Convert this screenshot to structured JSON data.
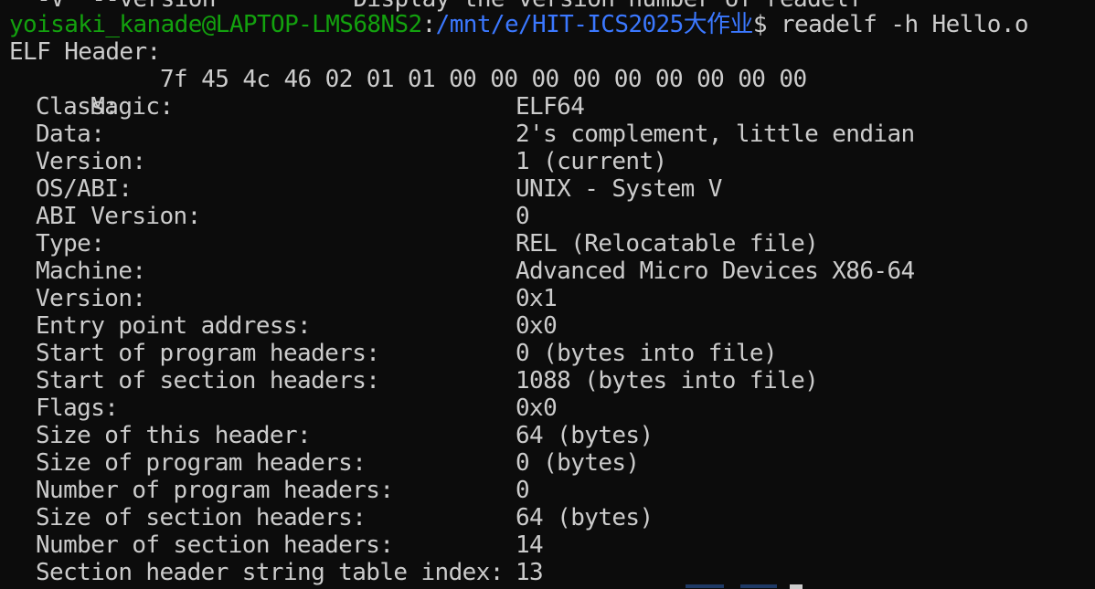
{
  "scrollback_top": "  -V  --version          Display the version number of readelf",
  "prompt": {
    "user_host": "yoisaki_kanade@LAPTOP-LMS68NS2",
    "separator": ":",
    "path": "/mnt/e/HIT-ICS2025大作业",
    "symbol": "$",
    "command": " readelf -h Hello.o"
  },
  "header_title": "ELF Header:",
  "magic": {
    "label": "Magic:",
    "value": "7f 45 4c 46 02 01 01 00 00 00 00 00 00 00 00 00"
  },
  "fields": [
    {
      "label": "Class:",
      "value": "ELF64"
    },
    {
      "label": "Data:",
      "value": "2's complement, little endian"
    },
    {
      "label": "Version:",
      "value": "1 (current)"
    },
    {
      "label": "OS/ABI:",
      "value": "UNIX - System V"
    },
    {
      "label": "ABI Version:",
      "value": "0"
    },
    {
      "label": "Type:",
      "value": "REL (Relocatable file)"
    },
    {
      "label": "Machine:",
      "value": "Advanced Micro Devices X86-64"
    },
    {
      "label": "Version:",
      "value": "0x1"
    },
    {
      "label": "Entry point address:",
      "value": "0x0"
    },
    {
      "label": "Start of program headers:",
      "value": "0 (bytes into file)"
    },
    {
      "label": "Start of section headers:",
      "value": "1088 (bytes into file)"
    },
    {
      "label": "Flags:",
      "value": "0x0"
    },
    {
      "label": "Size of this header:",
      "value": "64 (bytes)"
    },
    {
      "label": "Size of program headers:",
      "value": "0 (bytes)"
    },
    {
      "label": "Number of program headers:",
      "value": "0"
    },
    {
      "label": "Size of section headers:",
      "value": "64 (bytes)"
    },
    {
      "label": "Number of section headers:",
      "value": "14"
    },
    {
      "label": "Section header string table index:",
      "value": "13"
    }
  ],
  "colors": {
    "background": "#0c0c0c",
    "text": "#cccccc",
    "user_host": "#13a10e",
    "path": "#3b78ff"
  }
}
